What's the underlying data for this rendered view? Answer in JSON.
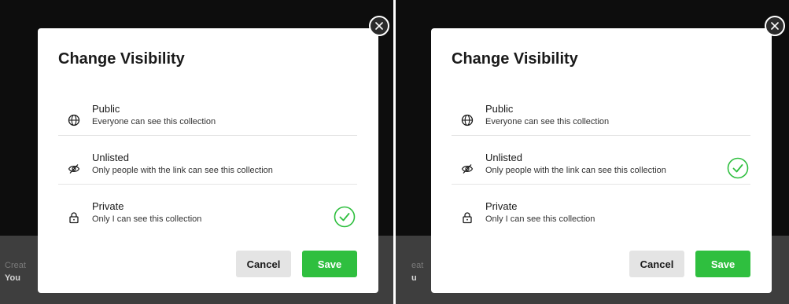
{
  "colors": {
    "accent": "#2fbf3f",
    "overlay": "#0d0d0d"
  },
  "panels": [
    {
      "background": {
        "label": "Creat",
        "user": "You"
      },
      "dialog": {
        "title": "Change Visibility",
        "options": [
          {
            "label": "Public",
            "description": "Everyone can see this collection",
            "icon": "globe-icon",
            "selected": false
          },
          {
            "label": "Unlisted",
            "description": "Only people with the link can see this collection",
            "icon": "eye-slash-icon",
            "selected": false
          },
          {
            "label": "Private",
            "description": "Only I can see this collection",
            "icon": "lock-icon",
            "selected": true
          }
        ],
        "cancel_label": "Cancel",
        "save_label": "Save"
      }
    },
    {
      "background": {
        "label": "eat",
        "user": "u"
      },
      "dialog": {
        "title": "Change Visibility",
        "options": [
          {
            "label": "Public",
            "description": "Everyone can see this collection",
            "icon": "globe-icon",
            "selected": false
          },
          {
            "label": "Unlisted",
            "description": "Only people with the link can see this collection",
            "icon": "eye-slash-icon",
            "selected": true
          },
          {
            "label": "Private",
            "description": "Only I can see this collection",
            "icon": "lock-icon",
            "selected": false
          }
        ],
        "cancel_label": "Cancel",
        "save_label": "Save"
      }
    }
  ]
}
